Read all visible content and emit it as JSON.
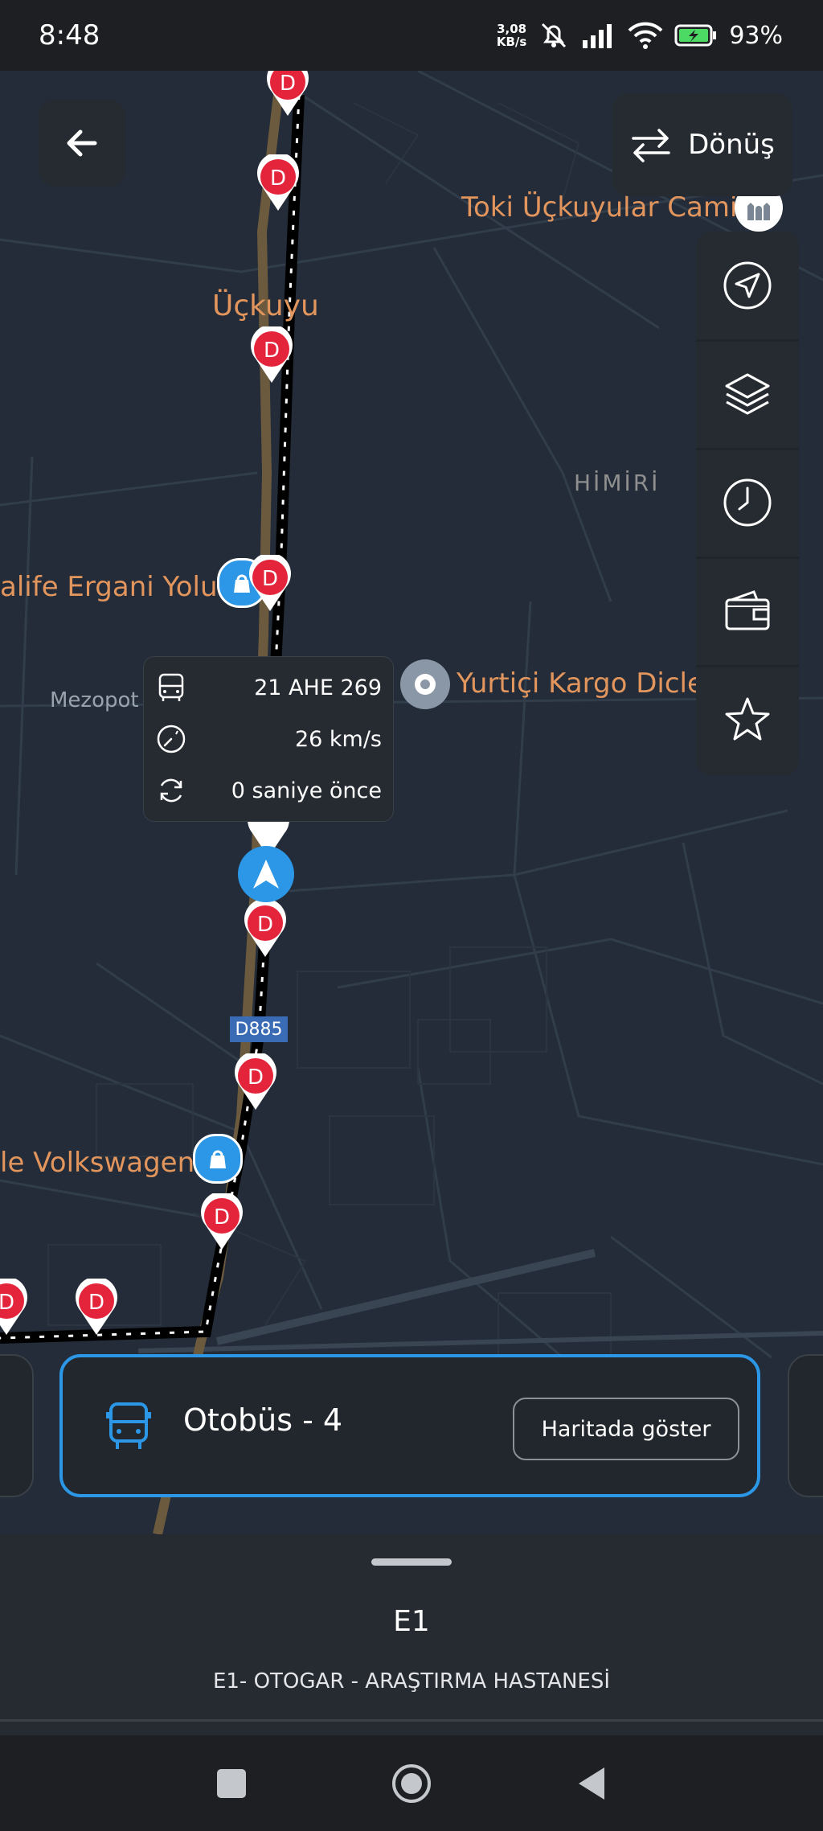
{
  "status_bar": {
    "time": "8:48",
    "net_speed_value": "3,08",
    "net_speed_unit": "KB/s",
    "battery": "93%"
  },
  "map": {
    "labels": {
      "toki": "Toki Üçkuyular Cami",
      "uckuyu": "Üçkuyu",
      "himiri": "HİMİRİ",
      "ergani": "alife Ergani Yolu",
      "mezopot": "Mezopot",
      "yurtici": "Yurtiçi Kargo Dicle",
      "volkswagen": "le Volkswagen"
    },
    "road_badge": "D885",
    "stop_letter": "D"
  },
  "top": {
    "donus_label": "Dönüş"
  },
  "side_panel": {
    "items": [
      "navigate-icon",
      "layers-icon",
      "clock-icon",
      "wallet-icon",
      "star-icon"
    ]
  },
  "vehicle_info": {
    "plate": "21 AHE 269",
    "speed": "26 km/s",
    "updated": "0 saniye önce"
  },
  "vehicle_card": {
    "label": "Otobüs - 4",
    "button": "Haritada göster"
  },
  "bottom_sheet": {
    "route_code": "E1",
    "route_name": "E1- OTOGAR - ARAŞTIRMA HASTANESİ"
  },
  "colors": {
    "accent": "#2b97e6",
    "stop_red": "#e3243b",
    "poi_orange": "#e2955c",
    "road_badge": "#3a6cb5"
  }
}
